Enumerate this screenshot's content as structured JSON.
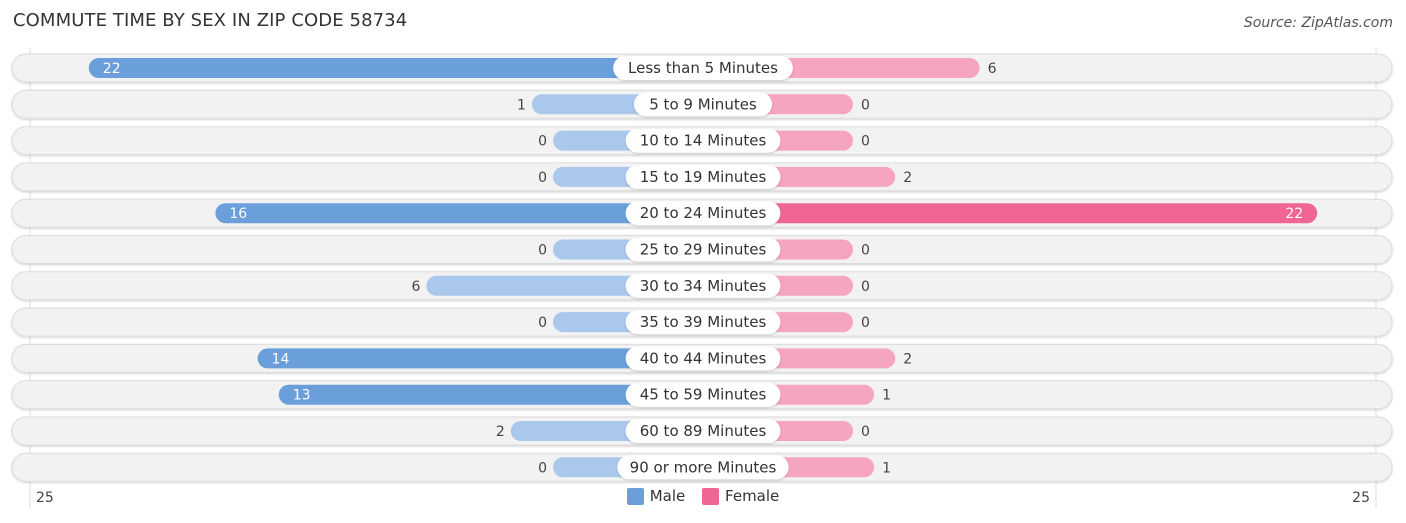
{
  "header": {
    "title": "COMMUTE TIME BY SEX IN ZIP CODE 58734",
    "source": "Source: ZipAtlas.com"
  },
  "colors": {
    "male": "#6a9fdc",
    "male_light": "#a9c8ec",
    "female": "#f06592",
    "female_light": "#f5a5bf",
    "row_bg": "#f2f2f2"
  },
  "legend": [
    {
      "label": "Male",
      "series": "male"
    },
    {
      "label": "Female",
      "series": "female"
    }
  ],
  "chart_data": {
    "type": "bar",
    "orientation": "horizontal-diverging",
    "title": "COMMUTE TIME BY SEX IN ZIP CODE 58734",
    "categories": [
      "Less than 5 Minutes",
      "5 to 9 Minutes",
      "10 to 14 Minutes",
      "15 to 19 Minutes",
      "20 to 24 Minutes",
      "25 to 29 Minutes",
      "30 to 34 Minutes",
      "35 to 39 Minutes",
      "40 to 44 Minutes",
      "45 to 59 Minutes",
      "60 to 89 Minutes",
      "90 or more Minutes"
    ],
    "series": [
      {
        "name": "Male",
        "values": [
          22,
          1,
          0,
          0,
          16,
          0,
          6,
          0,
          14,
          13,
          2,
          0
        ]
      },
      {
        "name": "Female",
        "values": [
          6,
          0,
          0,
          2,
          22,
          0,
          0,
          0,
          2,
          1,
          0,
          1
        ]
      }
    ],
    "axis": {
      "left_label": "25",
      "right_label": "25",
      "max": 25
    },
    "legend_position": "bottom-center",
    "grid": false
  }
}
